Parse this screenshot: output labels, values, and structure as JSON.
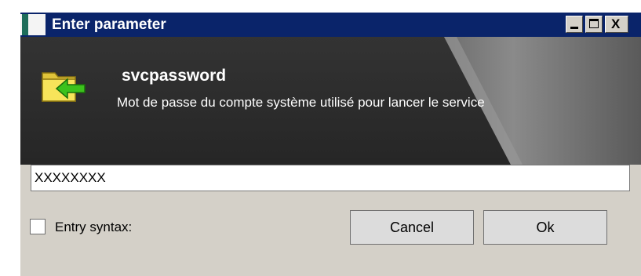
{
  "window": {
    "title": "Enter parameter",
    "controls": {
      "minimize_icon": "minimize-icon",
      "maximize_icon": "maximize-icon",
      "close_glyph": "X"
    }
  },
  "header": {
    "icon": "folder-arrow-icon",
    "param_name": "svcpassword",
    "param_description": "Mot de passe du compte système utilisé pour lancer le service"
  },
  "input": {
    "value": "XXXXXXXX"
  },
  "options": {
    "entry_syntax_label": "Entry syntax:",
    "entry_syntax_checked": false
  },
  "buttons": {
    "cancel_label": "Cancel",
    "ok_label": "Ok"
  },
  "colors": {
    "titlebar": "#0a246a",
    "header_bg": "#2d2d2d",
    "window_bg": "#d4d0c8"
  }
}
